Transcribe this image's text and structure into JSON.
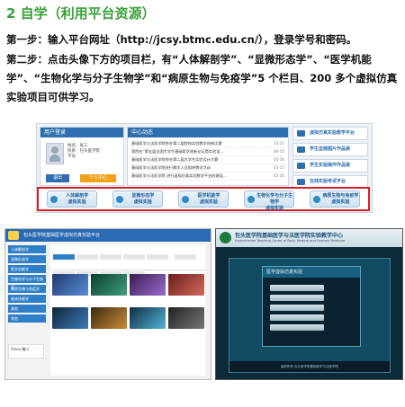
{
  "heading": "2  自学（利用平台资源）",
  "step1": "第一步：输入平台网址（http://jcsy.btmc.edu.cn/），登录学号和密码。",
  "step2": "第二步：点击头像下方的项目栏，有“人体解剖学”、“显微形态学”、“医学机能学”、“生物化学与分子生物学”和“病原生物与免疫学”5 个栏目、200 多个虚拟仿真实验项目可供学习。",
  "portal": {
    "login_box_title": "用户登录",
    "user_info": [
      "姓名：张三",
      "院系：包头医学院",
      "学号："
    ],
    "exit_button": "退出",
    "center_button": "个人中心",
    "news_title": "中心动态",
    "news": [
      {
        "t": "基础医学与法医学院举办第二届院校实验教学创新比赛",
        "d": "10-21"
      },
      {
        "t": "我院在“第五届全国大学生基础医学创新论坛暨实验设…",
        "d": "08-10"
      },
      {
        "t": "基础医学与法医学院举办第二届大学生实验设计大赛",
        "d": "05-30"
      },
      {
        "t": "基础医学与法医学院进行教学人员相关教学活动",
        "d": "03-15"
      },
      {
        "t": "基础医学与法医学院 进行虚拟仿真实验教学平台的建设…",
        "d": "02-20"
      }
    ],
    "right_links": [
      "虚拟仿真实验教学平台",
      "学生显微图片作品展",
      "学生实验操作作品展",
      "在线实验考试平台"
    ],
    "modules": [
      {
        "name": "人体解剖学",
        "sub": "虚拟实验"
      },
      {
        "name": "显微形态学",
        "sub": "虚拟实验"
      },
      {
        "name": "医学机能学",
        "sub": "虚拟实验"
      },
      {
        "name": "生物化学与分子生物学",
        "sub": "虚拟实验"
      },
      {
        "name": "病原生物与免疫学",
        "sub": "虚拟实验"
      }
    ]
  },
  "shot2": {
    "top_title": "包头医学院基础医学虚拟仿真实验平台",
    "side_items": [
      "人体解剖学",
      "显微形态学",
      "医学机能学",
      "生物化学与分子生物学",
      "病原生物与免疫学",
      "临床技能学",
      "其他",
      "其他"
    ],
    "user_name": "Sinus 端口"
  },
  "shot3": {
    "title": "包头医学院基础医学与法医学院实验教学中心",
    "subtitle": "Experimental Teaching Center of Basic Medical and Forensic Medicine",
    "panel_title": "医学虚拟仿真实验",
    "footer": "版权所有 包头医学院基础医学与法医学院"
  },
  "colors": {
    "heading_green": "#3aa039",
    "highlight_red": "#d81e2a",
    "portal_blue": "#2f6fb0"
  }
}
